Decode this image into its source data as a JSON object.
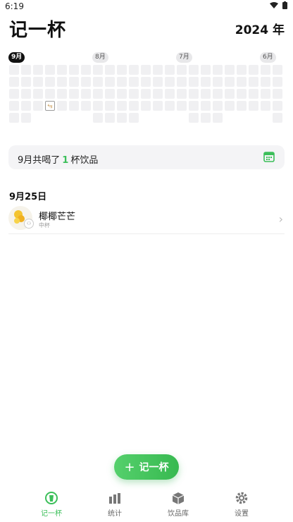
{
  "status": {
    "time": "6:19"
  },
  "header": {
    "title": "记一杯",
    "year": "2024 年"
  },
  "calendar": {
    "months": [
      {
        "label": "9月",
        "active": true
      },
      {
        "label": "8月",
        "active": false
      },
      {
        "label": "7月",
        "active": false
      },
      {
        "label": "6月",
        "active": false
      }
    ],
    "marked_cell_icon": "drink-cup-icon"
  },
  "summary": {
    "prefix": "9月共喝了",
    "count": "1",
    "suffix": "杯饮品",
    "icon": "calendar-icon"
  },
  "records": {
    "day_label": "9月25日",
    "items": [
      {
        "name": "椰椰芒芒",
        "size": "中杯",
        "icon": "mango-drink-icon"
      }
    ]
  },
  "add_button": {
    "label": "记一杯"
  },
  "tabs": [
    {
      "label": "记一杯",
      "icon": "cup-record-icon",
      "active": true
    },
    {
      "label": "统计",
      "icon": "bar-chart-icon",
      "active": false
    },
    {
      "label": "饮品库",
      "icon": "box-icon",
      "active": false
    },
    {
      "label": "设置",
      "icon": "gear-icon",
      "active": false
    }
  ],
  "colors": {
    "accent": "#3cbf5a",
    "cell": "#f0f0f2",
    "summary_bg": "#f4f4f6"
  }
}
